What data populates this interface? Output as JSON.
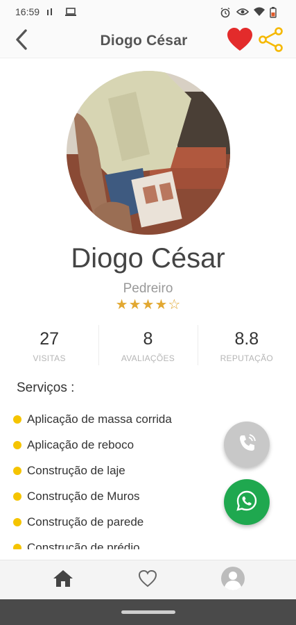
{
  "status_bar": {
    "time": "16:59",
    "icons": [
      "sim-icon",
      "laptop-icon",
      "alarm-icon",
      "eye-icon",
      "wifi-icon",
      "battery-icon"
    ]
  },
  "app_bar": {
    "title": "Diogo César",
    "back_icon": "chevron-left-icon",
    "favorite_icon": "heart-icon",
    "share_icon": "share-icon"
  },
  "profile": {
    "name": "Diogo César",
    "role": "Pedreiro",
    "rating": 4,
    "rating_max": 5
  },
  "stats": [
    {
      "value": "27",
      "label": "VISITAS"
    },
    {
      "value": "8",
      "label": "AVALIAÇÕES"
    },
    {
      "value": "8.8",
      "label": "REPUTAÇÃO"
    }
  ],
  "services": {
    "title": "Serviços :",
    "items": [
      "Aplicação de massa corrida",
      "Aplicação de reboco",
      "Construção de laje",
      "Construção de Muros",
      "Construção de parede",
      "Construção de prédio"
    ]
  },
  "fabs": {
    "call_icon": "phone-icon",
    "whatsapp_icon": "whatsapp-icon"
  },
  "bottom_nav": {
    "items": [
      "home-icon",
      "heart-outline-icon",
      "user-avatar-icon"
    ]
  },
  "colors": {
    "favorite": "#e32b2b",
    "share": "#f5b800",
    "star": "#e2a832",
    "service_dot": "#f5c400",
    "whatsapp": "#1fa84f",
    "call": "#c8c8c8"
  }
}
